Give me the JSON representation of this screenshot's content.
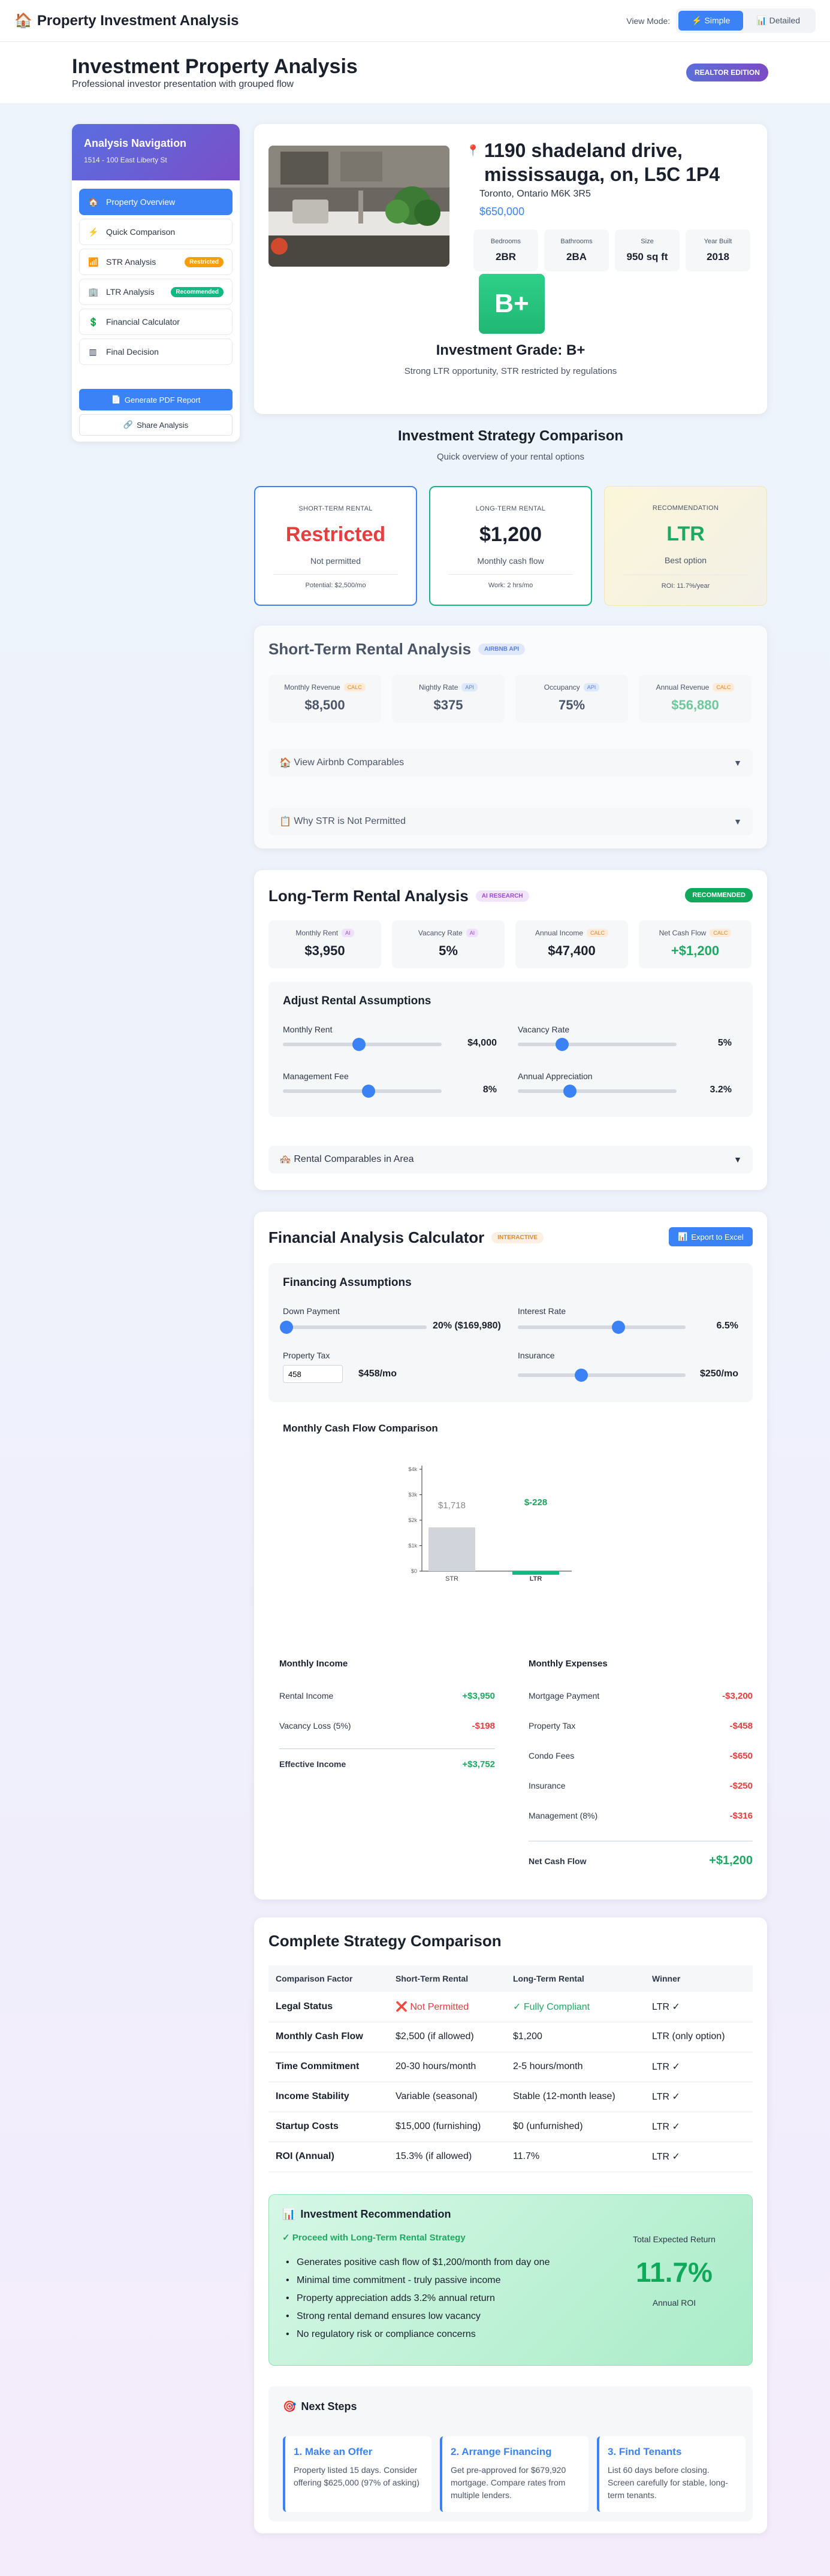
{
  "app": {
    "title": "Property Investment Analysis",
    "view_mode_label": "View Mode:",
    "view_simple": "Simple",
    "view_detailed": "Detailed"
  },
  "header": {
    "title": "Investment Property Analysis",
    "subtitle": "Professional investor presentation with grouped flow",
    "badge": "REALTOR EDITION"
  },
  "sidebar": {
    "title": "Analysis Navigation",
    "address": "1514 - 100 East Liberty St",
    "items": [
      {
        "label": "Property Overview",
        "icon": "home-icon",
        "active": true
      },
      {
        "label": "Quick Comparison",
        "icon": "lightning-icon"
      },
      {
        "label": "STR Analysis",
        "icon": "bar-chart-icon",
        "tag": "Restricted",
        "tag_color": "#f59e0b"
      },
      {
        "label": "LTR Analysis",
        "icon": "building-icon",
        "tag": "Recommended",
        "tag_color": "#10b981"
      },
      {
        "label": "Financial Calculator",
        "icon": "dollar-icon"
      },
      {
        "label": "Final Decision",
        "icon": "columns-icon"
      }
    ],
    "pdf_button": "Generate PDF Report",
    "share_button": "Share Analysis"
  },
  "property": {
    "address": "1190 shadeland drive, mississauga, on, L5C 1P4",
    "city": "Toronto, Ontario M6K 3R5",
    "price": "$650,000",
    "facts": [
      {
        "label": "Bedrooms",
        "value": "2BR"
      },
      {
        "label": "Bathrooms",
        "value": "2BA"
      },
      {
        "label": "Size",
        "value": "950 sq ft"
      },
      {
        "label": "Year Built",
        "value": "2018"
      }
    ],
    "grade": "B+",
    "grade_title": "Investment Grade: B+",
    "grade_sub": "Strong LTR opportunity, STR restricted by regulations"
  },
  "strategy": {
    "title": "Investment Strategy Comparison",
    "subtitle": "Quick overview of your rental options",
    "cards": [
      {
        "label": "SHORT-TERM RENTAL",
        "value": "Restricted",
        "sub": "Not permitted",
        "foot": "Potential: $2,500/mo",
        "color": "#e53e3e"
      },
      {
        "label": "LONG-TERM RENTAL",
        "value": "$1,200",
        "sub": "Monthly cash flow",
        "foot": "Work: 2 hrs/mo",
        "color": "#1a202c"
      },
      {
        "label": "RECOMMENDATION",
        "value": "LTR",
        "sub": "Best option",
        "foot": "ROI: 11.7%/year",
        "color": "#1fa862"
      }
    ]
  },
  "str": {
    "title": "Short-Term Rental Analysis",
    "pill": "AIRBNB API",
    "metrics": [
      {
        "label": "Monthly Revenue",
        "tag": "CALC",
        "value": "$8,500"
      },
      {
        "label": "Nightly Rate",
        "tag": "API",
        "value": "$375"
      },
      {
        "label": "Occupancy",
        "tag": "API",
        "value": "75%"
      },
      {
        "label": "Annual Revenue",
        "tag": "CALC",
        "value": "$56,880"
      }
    ],
    "expander1": "View Airbnb Comparables",
    "expander2": "Why STR is Not Permitted"
  },
  "ltr": {
    "title": "Long-Term Rental Analysis",
    "pill": "AI RESEARCH",
    "badge": "RECOMMENDED",
    "metrics": [
      {
        "label": "Monthly Rent",
        "tag": "AI",
        "value": "$3,950"
      },
      {
        "label": "Vacancy Rate",
        "tag": "AI",
        "value": "5%"
      },
      {
        "label": "Annual Income",
        "tag": "CALC",
        "value": "$47,400"
      },
      {
        "label": "Net Cash Flow",
        "tag": "CALC",
        "value": "+$1,200"
      }
    ],
    "adjust_title": "Adjust Rental Assumptions",
    "sliders": [
      {
        "label": "Monthly Rent",
        "value": "$4,000",
        "fraction": 0.48
      },
      {
        "label": "Vacancy Rate",
        "value": "5%",
        "fraction": 0.28
      },
      {
        "label": "Management Fee",
        "value": "8%",
        "fraction": 0.54
      },
      {
        "label": "Annual Appreciation",
        "value": "3.2%",
        "fraction": 0.33
      }
    ],
    "expander": "Rental Comparables in Area"
  },
  "calc": {
    "title": "Financial Analysis Calculator",
    "pill": "INTERACTIVE",
    "export": "Export to Excel",
    "assump_title": "Financing Assumptions",
    "down_label": "Down Payment",
    "down_value": "20% ($169,980)",
    "down_fraction": 0.0,
    "rate_label": "Interest Rate",
    "rate_value": "6.5%",
    "rate_fraction": 0.6,
    "tax_label": "Property Tax",
    "tax_input": "458",
    "tax_value": "$458/mo",
    "ins_label": "Insurance",
    "ins_value": "$250/mo",
    "ins_fraction": 0.38,
    "chart_title": "Monthly Cash Flow Comparison",
    "income_title": "Monthly Income",
    "income_rows": [
      {
        "label": "Rental Income",
        "value": "+$3,950",
        "color": "#1fa862"
      },
      {
        "label": "Vacancy Loss (5%)",
        "value": "-$198",
        "color": "#e53e3e"
      }
    ],
    "effective_label": "Effective Income",
    "effective_value": "+$3,752",
    "expense_title": "Monthly Expenses",
    "expense_rows": [
      {
        "label": "Mortgage Payment",
        "value": "-$3,200"
      },
      {
        "label": "Property Tax",
        "value": "-$458"
      },
      {
        "label": "Condo Fees",
        "value": "-$650"
      },
      {
        "label": "Insurance",
        "value": "-$250"
      },
      {
        "label": "Management (8%)",
        "value": "-$316"
      }
    ],
    "net_label": "Net Cash Flow",
    "net_value": "+$1,200"
  },
  "chart_data": {
    "type": "bar",
    "title": "Monthly Cash Flow Comparison",
    "categories": [
      "STR",
      "LTR"
    ],
    "values": [
      1718,
      -228
    ],
    "labels": [
      "$1,718",
      "$-228"
    ],
    "ylim": [
      0,
      4000
    ],
    "yticks": [
      "$0",
      "$1k",
      "$2k",
      "$3k",
      "$4k"
    ],
    "colors": [
      "#d1d5db",
      "#10b981"
    ]
  },
  "complete": {
    "title": "Complete Strategy Comparison",
    "headers": [
      "Comparison Factor",
      "Short-Term Rental",
      "Long-Term Rental",
      "Winner"
    ],
    "rows": [
      [
        "Legal Status",
        "❌ Not Permitted",
        "✓ Fully Compliant",
        "LTR ✓"
      ],
      [
        "Monthly Cash Flow",
        "$2,500 (if allowed)",
        "$1,200",
        "LTR (only option)"
      ],
      [
        "Time Commitment",
        "20-30 hours/month",
        "2-5 hours/month",
        "LTR ✓"
      ],
      [
        "Income Stability",
        "Variable (seasonal)",
        "Stable (12-month lease)",
        "LTR ✓"
      ],
      [
        "Startup Costs",
        "$15,000 (furnishing)",
        "$0 (unfurnished)",
        "LTR ✓"
      ],
      [
        "ROI (Annual)",
        "15.3% (if allowed)",
        "11.7%",
        "LTR ✓"
      ]
    ],
    "reco_title": "Investment Recommendation",
    "reco_sub": "✓ Proceed with Long-Term Rental Strategy",
    "reco_items": [
      "Generates positive cash flow of $1,200/month from day one",
      "Minimal time commitment - truly passive income",
      "Property appreciation adds 3.2% annual return",
      "Strong rental demand ensures low vacancy",
      "No regulatory risk or compliance concerns"
    ],
    "total_label": "Total Expected Return",
    "total_value": "11.7%",
    "total_sub": "Annual ROI",
    "next_title": "Next Steps",
    "steps": [
      {
        "title": "1. Make an Offer",
        "desc": "Property listed 15 days. Consider offering $625,000 (97% of asking)"
      },
      {
        "title": "2. Arrange Financing",
        "desc": "Get pre-approved for $679,920 mortgage. Compare rates from multiple lenders."
      },
      {
        "title": "3. Find Tenants",
        "desc": "List 60 days before closing. Screen carefully for stable, long-term tenants."
      }
    ]
  }
}
